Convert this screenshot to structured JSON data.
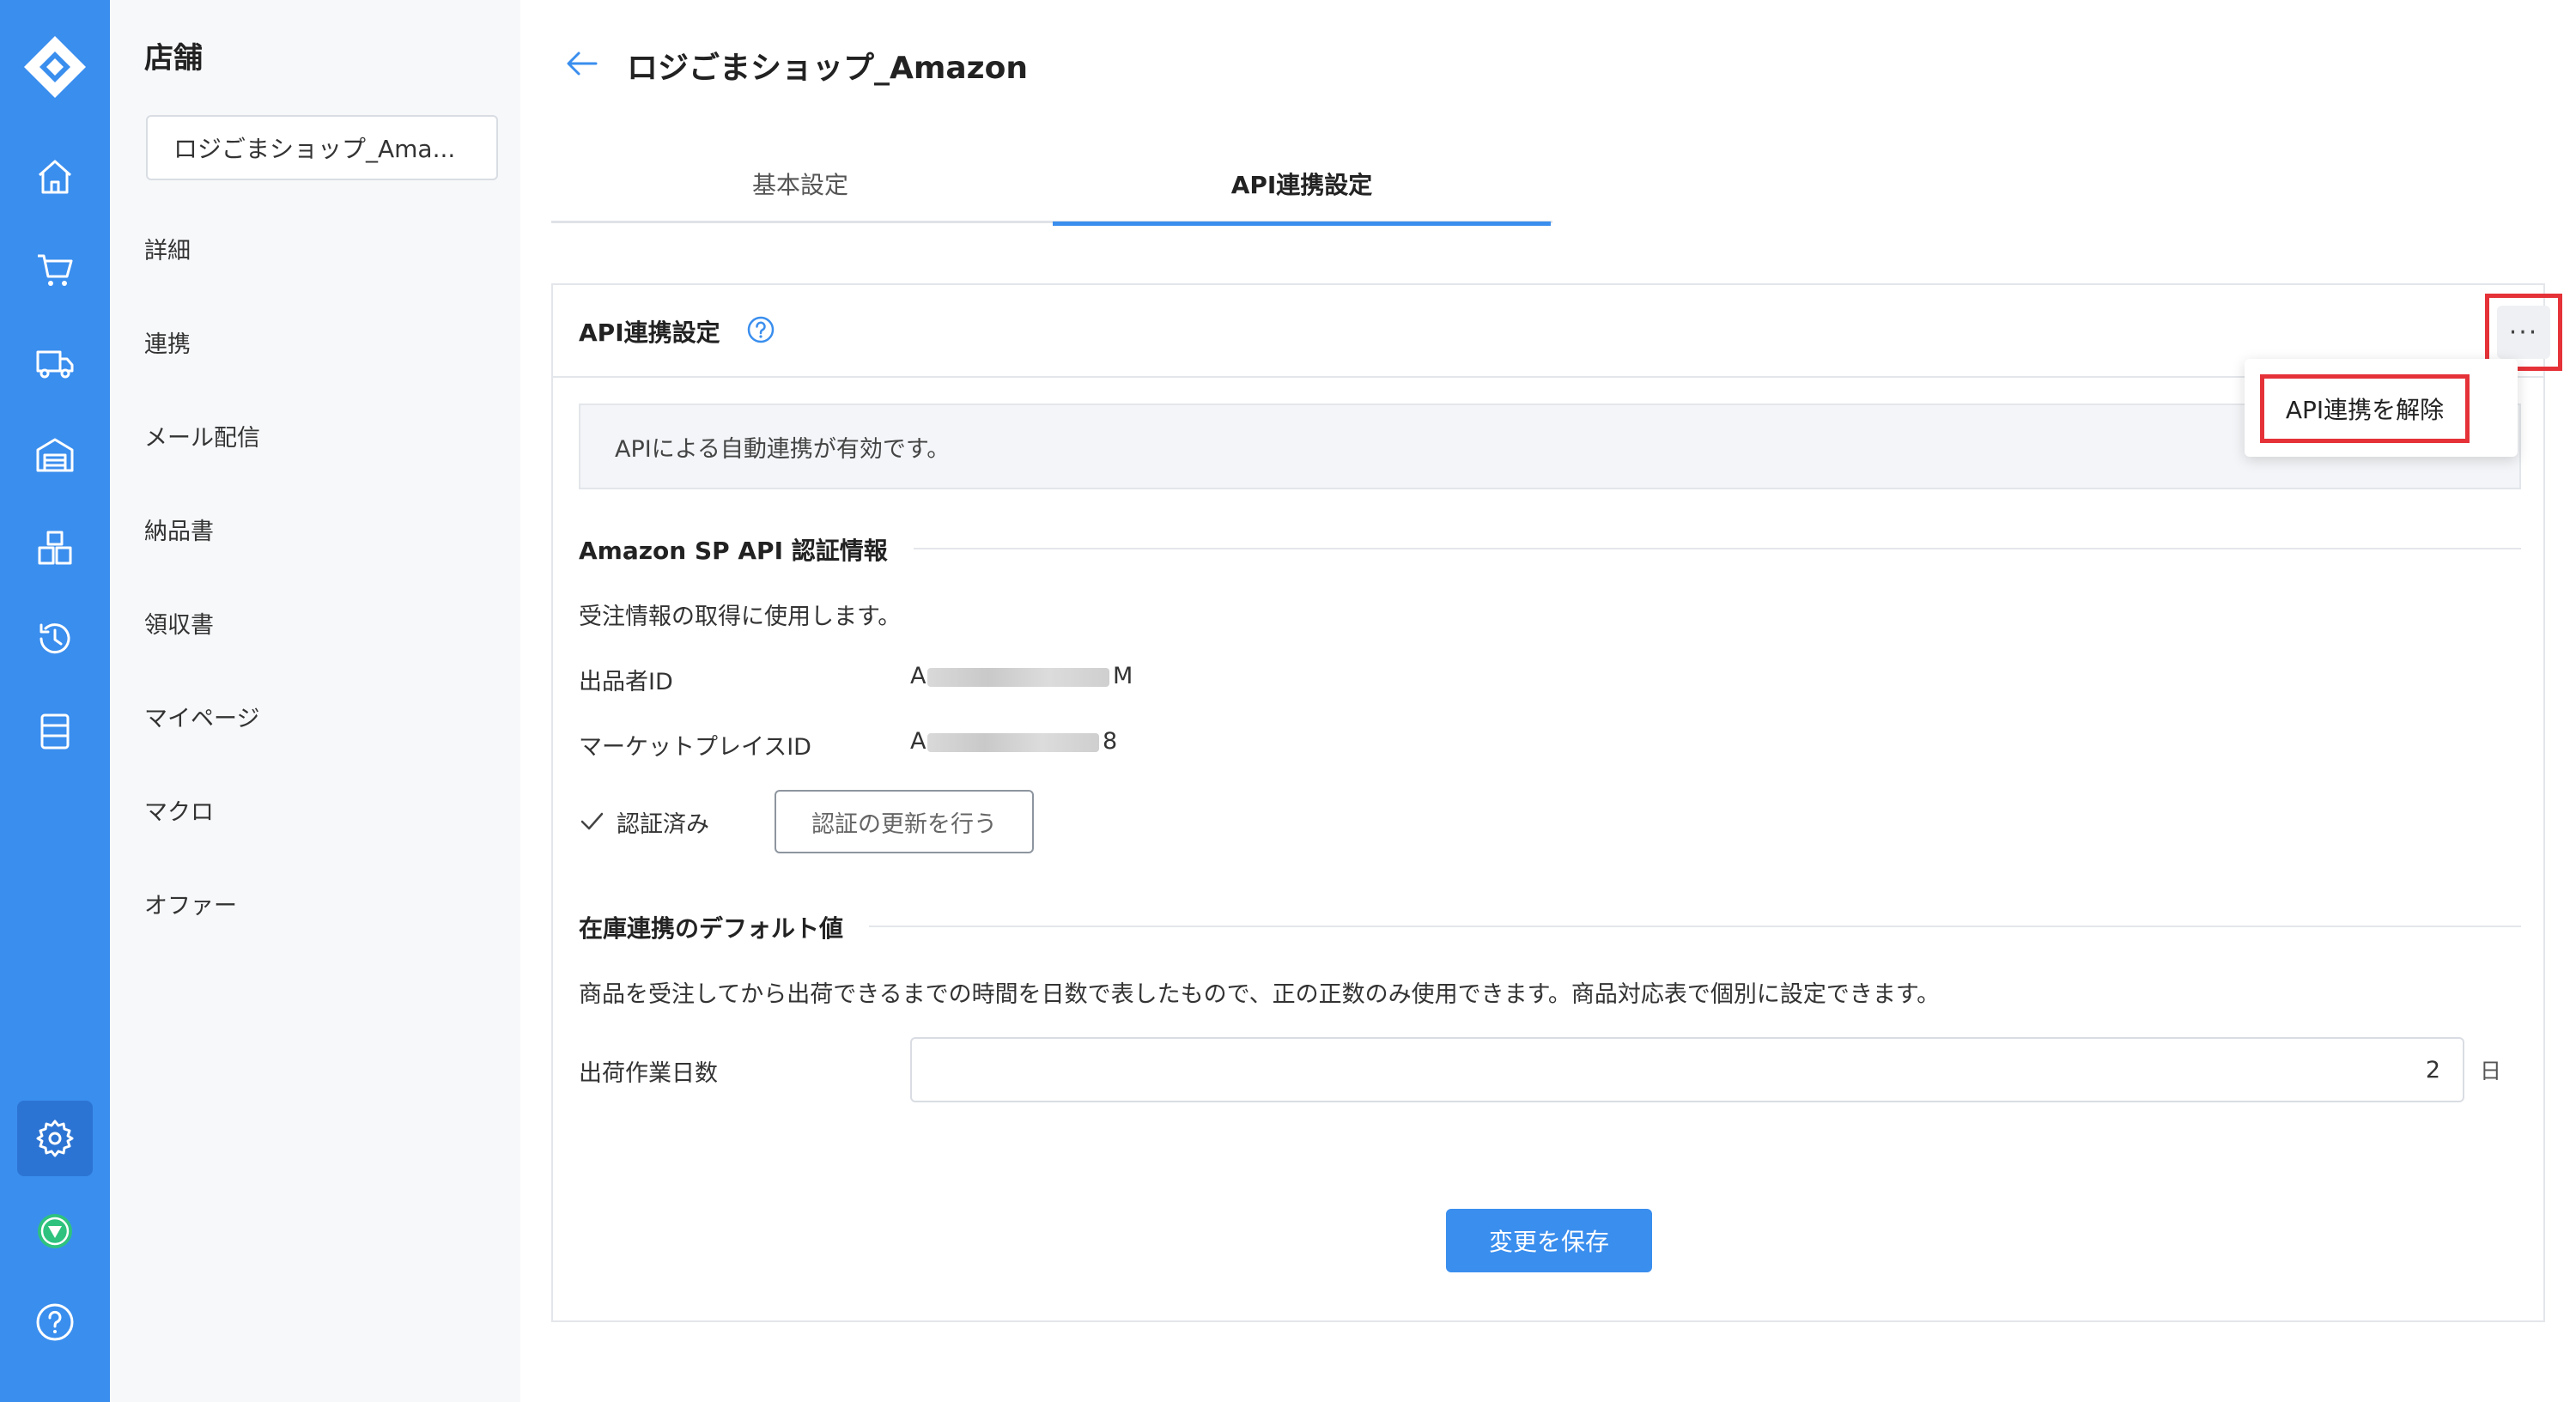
{
  "colors": {
    "rail": "#3a8eee",
    "accent": "#3a8eee",
    "highlight": "#e53238"
  },
  "rail": {
    "icons": [
      "app-logo-icon",
      "home-icon",
      "cart-icon",
      "truck-icon",
      "warehouse-icon",
      "boxes-icon",
      "history-icon",
      "list-icon",
      "settings-icon",
      "brand-icon",
      "help-icon"
    ]
  },
  "sidebar": {
    "title": "店舗",
    "store_select": "ロジごまショップ_Ama...",
    "items": [
      {
        "label": "詳細"
      },
      {
        "label": "連携"
      },
      {
        "label": "メール配信"
      },
      {
        "label": "納品書"
      },
      {
        "label": "領収書"
      },
      {
        "label": "マイページ"
      },
      {
        "label": "マクロ"
      },
      {
        "label": "オファー"
      }
    ]
  },
  "header": {
    "title": "ロジごまショップ_Amazon"
  },
  "tabs": [
    {
      "label": "基本設定"
    },
    {
      "label": "API連携設定"
    }
  ],
  "card": {
    "title": "API連携設定",
    "more_label": "···",
    "notice": "APIによる自動連携が有効です。"
  },
  "dropdown": {
    "item": "API連携を解除"
  },
  "sp_api": {
    "section_title": "Amazon SP API 認証情報",
    "description": "受注情報の取得に使用します。",
    "seller_id_label": "出品者ID",
    "seller_id_prefix": "A",
    "seller_id_suffix": "M",
    "marketplace_label": "マーケットプレイスID",
    "marketplace_prefix": "A",
    "marketplace_suffix": "8",
    "status": "認証済み",
    "renew_button": "認証の更新を行う"
  },
  "inventory": {
    "section_title": "在庫連携のデフォルト値",
    "description": "商品を受注してから出荷できるまでの時間を日数で表したもので、正の正数のみ使用できます。商品対応表で個別に設定できます。",
    "days_label": "出荷作業日数",
    "days_value": "2",
    "days_unit": "日"
  },
  "save_button": "変更を保存"
}
